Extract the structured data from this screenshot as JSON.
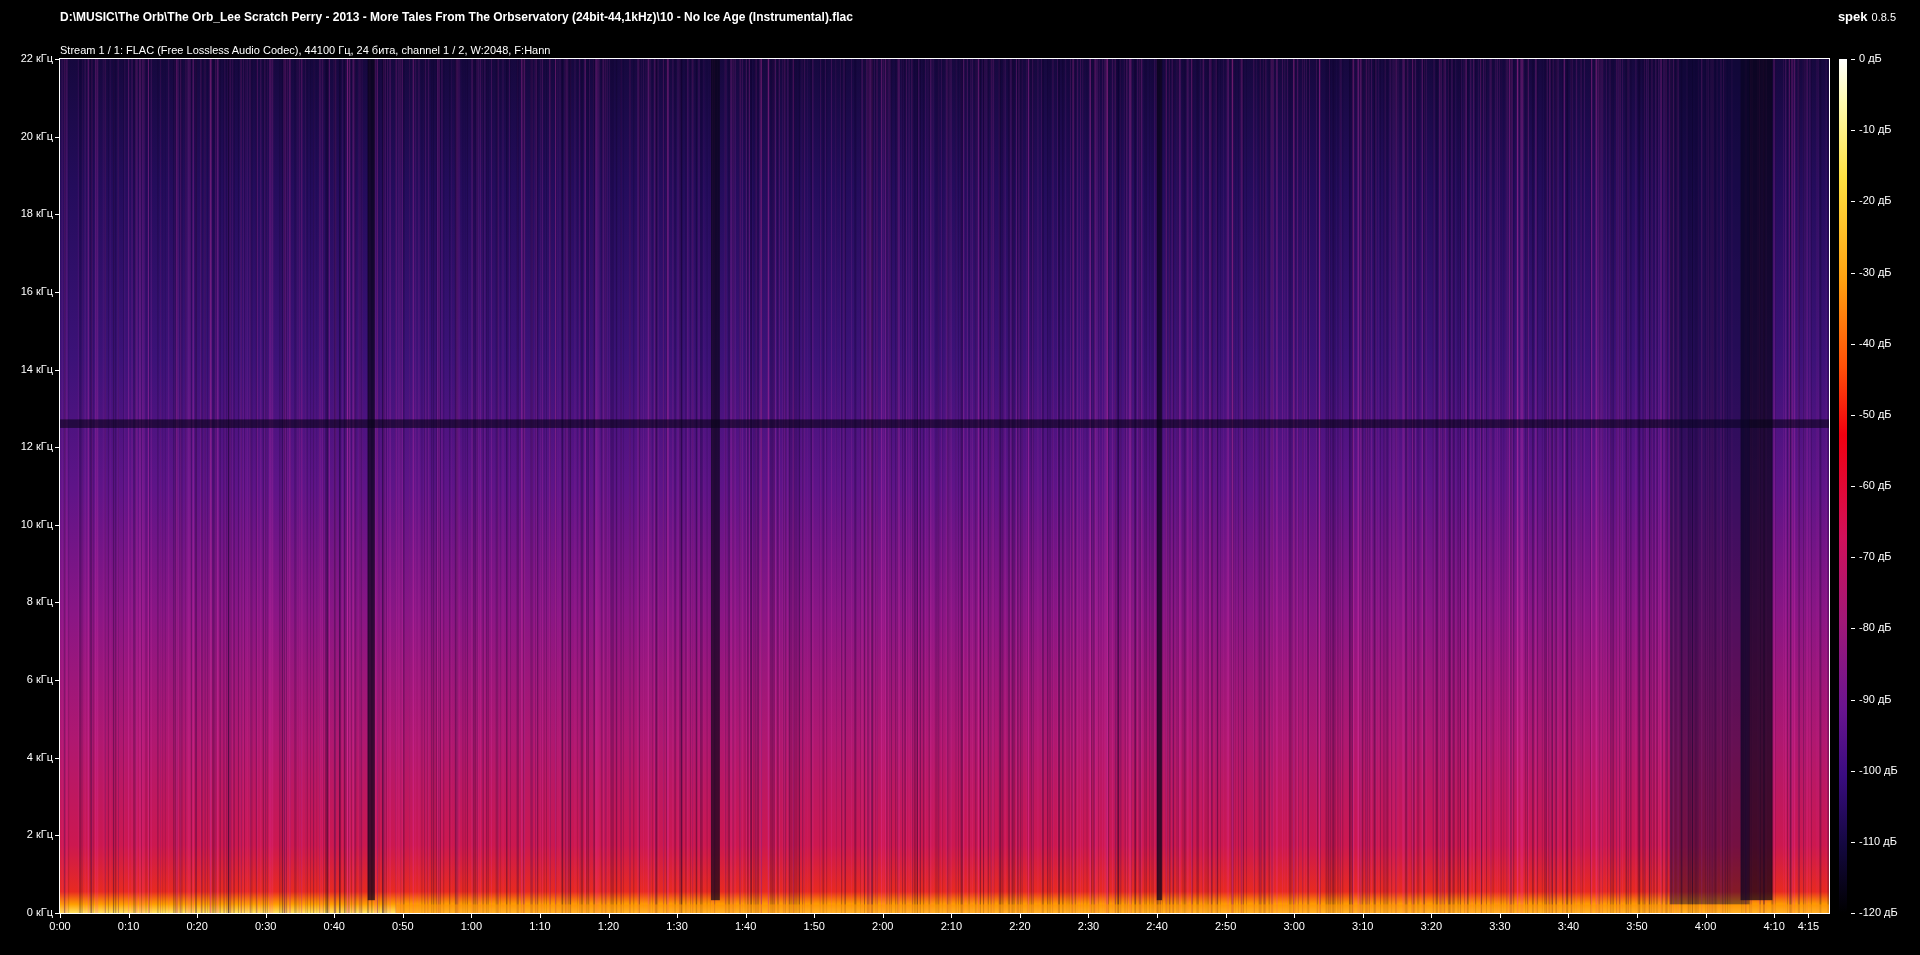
{
  "title": "D:\\MUSIC\\The Orb\\The Orb_Lee Scratch Perry - 2013 - More Tales From The Orbservatory (24bit-44,1kHz)\\10 - No Ice Age (Instrumental).flac",
  "stream_info": "Stream 1 / 1: FLAC (Free Lossless Audio Codec), 44100 Гц, 24 бита, channel 1 / 2, W:2048, F:Hann",
  "app": {
    "name": "spek",
    "version": "0.8.5"
  },
  "frequency_axis": [
    "22 кГц",
    "20 кГц",
    "18 кГц",
    "16 кГц",
    "14 кГц",
    "12 кГц",
    "10 кГц",
    "8 кГц",
    "6 кГц",
    "4 кГц",
    "2 кГц",
    "0 кГц"
  ],
  "time_axis": [
    "0:00",
    "0:10",
    "0:20",
    "0:30",
    "0:40",
    "0:50",
    "1:00",
    "1:10",
    "1:20",
    "1:30",
    "1:40",
    "1:50",
    "2:00",
    "2:10",
    "2:20",
    "2:30",
    "2:40",
    "2:50",
    "3:00",
    "3:10",
    "3:20",
    "3:30",
    "3:40",
    "3:50",
    "4:00",
    "4:10",
    "4:15"
  ],
  "level_scale": [
    "0 дБ",
    "-10 дБ",
    "-20 дБ",
    "-30 дБ",
    "-40 дБ",
    "-50 дБ",
    "-60 дБ",
    "-70 дБ",
    "-80 дБ",
    "-90 дБ",
    "-100 дБ",
    "-110 дБ",
    "-120 дБ"
  ]
}
